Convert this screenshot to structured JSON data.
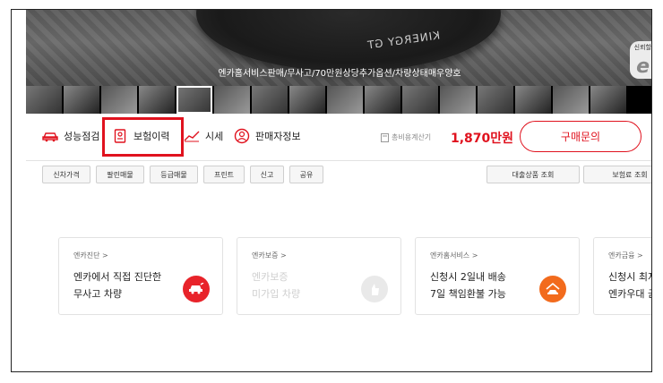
{
  "hero": {
    "caption": "엔카홈서비스판매/무사고/70만원상당추가옵션/차량상태매우양호",
    "tire_text": "KINERGY GT",
    "badge_small": "신뢰할",
    "badge_letter": "e"
  },
  "tabs": [
    {
      "label": "성능점검",
      "icon": "car-inspection-icon"
    },
    {
      "label": "보험이력",
      "icon": "document-icon"
    },
    {
      "label": "시세",
      "icon": "trend-chart-icon"
    },
    {
      "label": "판매자정보",
      "icon": "user-icon"
    }
  ],
  "purchase": {
    "fee_label": "총비용계산기",
    "price": "1,870만원",
    "buy_label": "구매문의"
  },
  "sub_buttons": [
    "신차가격",
    "팔린매물",
    "등급매물",
    "프린트",
    "신고",
    "공유"
  ],
  "sub_right_buttons": [
    "대출상품 조회",
    "보험료 조회"
  ],
  "cards": [
    {
      "category": "엔카진단 >",
      "line1": "엔카에서 직접 진단한",
      "line2": "무사고 차량",
      "icon": "car-diagnosis-icon",
      "color": "#e8232a"
    },
    {
      "category": "엔카보증 >",
      "line1": "엔카보증",
      "line2": "미가입 차량",
      "icon": "warranty-icon",
      "color": "#e9e9e9"
    },
    {
      "category": "엔카홈서비스 >",
      "line1": "신청시 2일내 배송",
      "line2": "7일 책임환불 가능",
      "icon": "home-delivery-icon",
      "color": "#f26b1d"
    },
    {
      "category": "엔카금융 >",
      "line1": "신청시 최저",
      "line2": "엔카우대 금",
      "icon": "finance-icon",
      "color": "#e8232a"
    }
  ],
  "colors": {
    "accent": "#e0121e"
  }
}
